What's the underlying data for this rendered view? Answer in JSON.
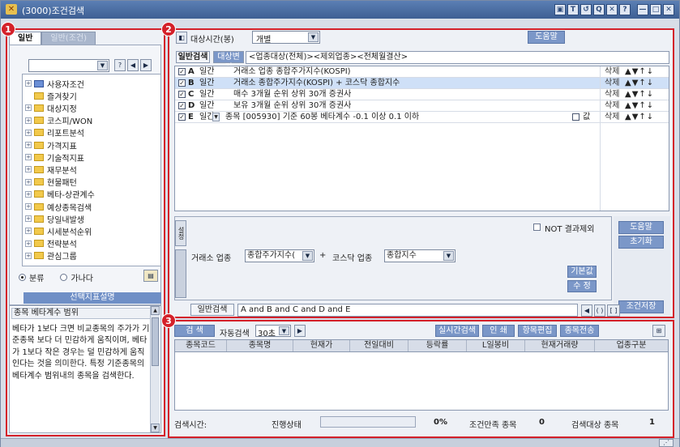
{
  "window": {
    "title": "(3000)조건검색",
    "titlebar_buttons": [
      "▣",
      "T",
      "↺",
      "Q",
      "✕",
      "?",
      "—",
      "□",
      "✕"
    ]
  },
  "annotations": {
    "badge1": "1",
    "badge2": "2",
    "badge3": "3"
  },
  "left": {
    "tabs": [
      "일반",
      "일반(조건)"
    ],
    "tree_items": [
      {
        "label": "사용자조건",
        "folder": "blue",
        "expand": "+"
      },
      {
        "label": "즐겨찾기",
        "folder": "yellow",
        "expand": ""
      },
      {
        "label": "대상지정",
        "folder": "yellow",
        "expand": "+"
      },
      {
        "label": "코스피/WON",
        "folder": "yellow",
        "expand": "+"
      },
      {
        "label": "리포트분석",
        "folder": "yellow",
        "expand": "+"
      },
      {
        "label": "가격지표",
        "folder": "yellow",
        "expand": "+"
      },
      {
        "label": "기술적지표",
        "folder": "yellow",
        "expand": "+"
      },
      {
        "label": "재무분석",
        "folder": "yellow",
        "expand": "+"
      },
      {
        "label": "현물패턴",
        "folder": "yellow",
        "expand": "+"
      },
      {
        "label": "베타-상관계수",
        "folder": "yellow",
        "expand": "+"
      },
      {
        "label": "예상종목검색",
        "folder": "yellow",
        "expand": "+"
      },
      {
        "label": "당일내발생",
        "folder": "yellow",
        "expand": "+"
      },
      {
        "label": "시세분석순위",
        "folder": "yellow",
        "expand": "+"
      },
      {
        "label": "전략분석",
        "folder": "yellow",
        "expand": "+"
      },
      {
        "label": "관심그룹",
        "folder": "yellow",
        "expand": "+"
      }
    ],
    "radio": {
      "option1": "분류",
      "option2": "가나다"
    },
    "desc_button": "선택지표설명",
    "desc_title": "종목 베타계수 범위",
    "desc_text": "베타가 1보다 크면 비교종목의 주가가 기준종목 보다 더 민감하게 움직이며, 베타가 1보다 작은 경우는 덜 민감하게 움직인다는 것을 의미한다. 특정 기준종목의 베타계수 범위내의 종목을 검색한다."
  },
  "top": {
    "target_label": "대상시간(봉)",
    "target_value": "개별",
    "help_button": "도움말",
    "tabs": [
      "일반검색",
      "대상변경"
    ],
    "criteria": "<업종대상(전체)><제외업종><전체월결산>",
    "conditions": [
      {
        "letter": "A",
        "period": "일간",
        "text": "거래소 업종 종합주가지수(KOSPI)",
        "selected": false,
        "extra": false
      },
      {
        "letter": "B",
        "period": "일간",
        "text": "거래소 종합주가지수(KOSPI) + 코스닥 종합지수",
        "selected": true,
        "extra": false
      },
      {
        "letter": "C",
        "period": "일간",
        "text": "매수 3개월 순위 상위 30개 증권사",
        "selected": false,
        "extra": false
      },
      {
        "letter": "D",
        "period": "일간",
        "text": "보유 3개월 순위 상위 30개 증권사",
        "selected": false,
        "extra": false
      },
      {
        "letter": "E",
        "period": "일간",
        "text": "종목 [005930] 기준 60봉 베타계수 -0.1 이상 0.1 이하",
        "selected": false,
        "extra": true
      }
    ],
    "cond_delete": "삭제",
    "cond_arrows": "▲▼↑↓",
    "extra_label": "값"
  },
  "editor": {
    "side_tab": "설정",
    "not_label": "NOT 결과제외",
    "field1_label": "거래소 업종",
    "field1_value": "종합주가지수(",
    "operator": "+",
    "field2_label": "코스닥 업종",
    "field2_value": "종합지수",
    "btn_default": "기본값",
    "btn_modify": "수 정",
    "right_btns": [
      "도움말",
      "초기화",
      "조건저장"
    ],
    "logic_label": "일반검색",
    "logic_value": "A and B and C and D and E"
  },
  "bottom": {
    "search_button": "검 색",
    "auto_label": "자동검색",
    "auto_value": "30초",
    "buttons": [
      "실시간검색",
      "인 쇄",
      "항목편집",
      "종목전송"
    ],
    "columns": [
      "종목코드",
      "종목명",
      "현재가",
      "전일대비",
      "등락률",
      "L일봉비",
      "현재거래량",
      "업종구분"
    ],
    "status": {
      "time_label": "검색시간:",
      "progress_label": "진행상태",
      "progress_value": "0%",
      "match_label": "조건만족 종목",
      "match_value": "0",
      "target_label": "검색대상 종목",
      "target_value": "1"
    }
  }
}
